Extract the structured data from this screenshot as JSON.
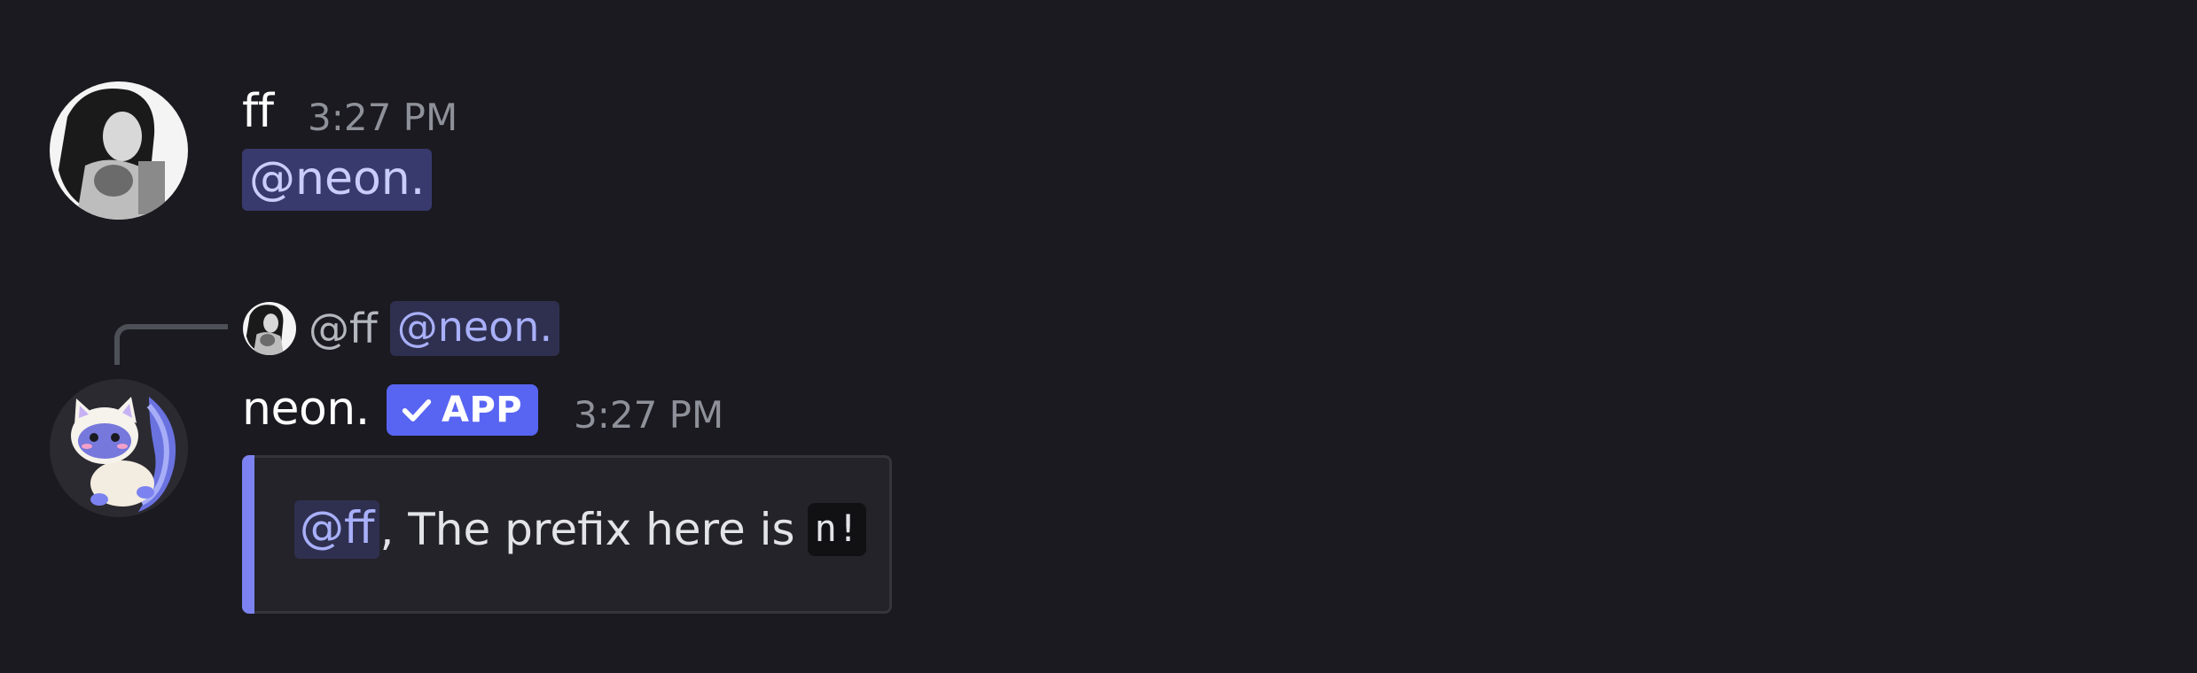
{
  "messages": [
    {
      "author": "ff",
      "timestamp": "3:27 PM",
      "avatar_icon": "user-photo-avatar",
      "content": {
        "mention": "@neon."
      }
    },
    {
      "author": "neon.",
      "timestamp": "3:27 PM",
      "avatar_icon": "cat-mascot-avatar",
      "badge": {
        "icon": "checkmark-icon",
        "label": "APP",
        "color": "#5865f2"
      },
      "reply": {
        "author": "@ff",
        "mention": "@neon.",
        "avatar_icon": "user-photo-avatar"
      },
      "embed": {
        "accent_color": "#7c83f0",
        "mention": "@ff",
        "text": ", The prefix here is",
        "code": "n!"
      }
    }
  ],
  "colors": {
    "background": "#1b1a20",
    "mention_bg": "#383a6d",
    "mention_text": "#c9cdfb",
    "timestamp": "#8e9199"
  }
}
